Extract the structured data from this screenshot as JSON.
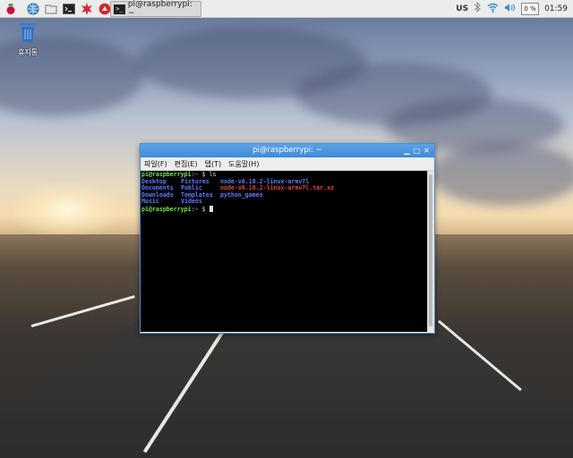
{
  "taskbar": {
    "launchers": [
      "raspberry-menu-icon",
      "web-browser-icon",
      "file-manager-icon",
      "terminal-icon",
      "mathematica-icon",
      "wolfram-icon"
    ],
    "task_window_label": "pi@raspberrypi: ~",
    "tray": {
      "keyboard_layout": "US",
      "cpu_usage": "0 %",
      "clock": "01:59"
    }
  },
  "desktop": {
    "trash_label": "휴지통"
  },
  "terminal": {
    "title": "pi@raspberrypi: ~",
    "menu": [
      "파일(F)",
      "편집(E)",
      "탭(T)",
      "도움말(H)"
    ],
    "prompt_user": "pi@raspberrypi",
    "prompt_path": "~",
    "prompt_symbol": "$",
    "command": "ls",
    "listing": [
      [
        "Desktop",
        "Pictures",
        "node-v6.10.2-linux-armv7l"
      ],
      [
        "Documents",
        "Public",
        "node-v6.10.2-linux-armv7l.tar.xz"
      ],
      [
        "Downloads",
        "Templates",
        "python_games"
      ],
      [
        "Music",
        "Videos",
        ""
      ]
    ]
  },
  "colors": {
    "title_bar": "#3f8ad8",
    "prompt": "#74e74a",
    "directory": "#5e7bff",
    "archive": "#e0453f"
  }
}
